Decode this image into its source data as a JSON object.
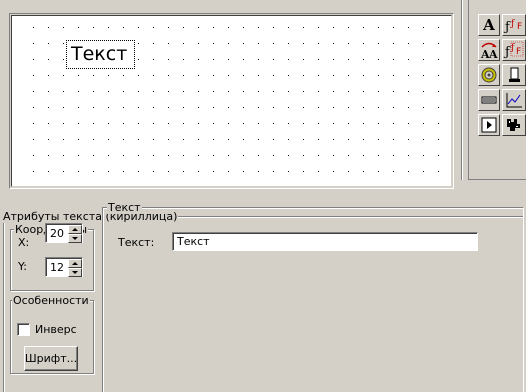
{
  "canvas": {
    "sample_text": "Текст"
  },
  "toolbox": {
    "tools": [
      {
        "icon": "text-tool-icon",
        "glyph": "A"
      },
      {
        "icon": "formula-tool-icon",
        "glyph": "ƒ"
      },
      {
        "icon": "rotate-text-tool-icon",
        "glyph": "A"
      },
      {
        "icon": "formula-alt-tool-icon",
        "glyph": "ƒ"
      },
      {
        "icon": "circle-tool-icon",
        "glyph": ""
      },
      {
        "icon": "device-tool-icon",
        "glyph": ""
      },
      {
        "icon": "bar-tool-icon",
        "glyph": ""
      },
      {
        "icon": "graph-tool-icon",
        "glyph": ""
      },
      {
        "icon": "play-tool-icon",
        "glyph": ""
      },
      {
        "icon": "bitmap-tool-icon",
        "glyph": ""
      }
    ]
  },
  "attributes": {
    "title": "Атрибуты текста (кириллица)",
    "coordinates": {
      "title": "Координаты",
      "x_label": "X:",
      "x_value": "20",
      "y_label": "Y:",
      "y_value": "12"
    },
    "features": {
      "title": "Особенности",
      "invert_label": "Инверс",
      "invert_checked": false,
      "font_button": "Шрифт..."
    },
    "text_group": {
      "title": "Текст",
      "text_label": "Текст:",
      "text_value": "Текст"
    }
  }
}
